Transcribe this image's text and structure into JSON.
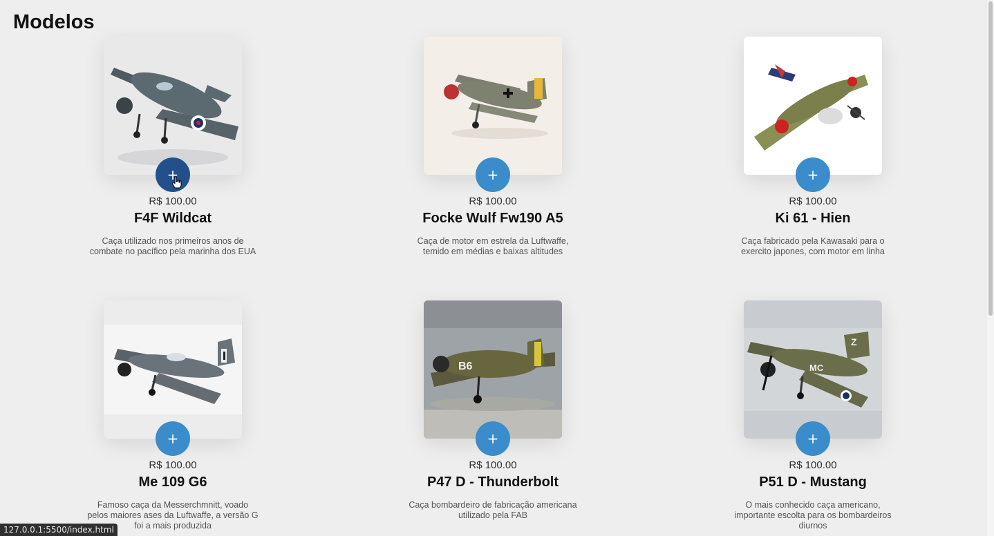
{
  "page": {
    "title": "Modelos"
  },
  "colors": {
    "accent": "#3a8cca",
    "accent_hover": "#23508b",
    "background": "#eeeeee"
  },
  "products": [
    {
      "price": "R$ 100.00",
      "name": "F4F Wildcat",
      "description": "Caça utilizado nos primeiros anos de combate no pacífico pela marinha dos EUA",
      "add_label": "+",
      "state": "hover"
    },
    {
      "price": "R$ 100.00",
      "name": "Focke Wulf Fw190 A5",
      "description": "Caça de motor em estrela da Luftwaffe, temido em médias e baixas altitudes",
      "add_label": "+"
    },
    {
      "price": "R$ 100.00",
      "name": "Ki 61 - Hien",
      "description": "Caça fabricado pela Kawasaki para o exercito japones, com motor em linha",
      "add_label": "+"
    },
    {
      "price": "R$ 100.00",
      "name": "Me 109 G6",
      "description": "Famoso caça da Messerchmnitt, voado pelos maiores ases da Luftwaffe, a versão G foi a mais produzida",
      "add_label": "+"
    },
    {
      "price": "R$ 100.00",
      "name": "P47 D - Thunderbolt",
      "description": "Caça bombardeiro de fabricação americana utilizado pela FAB",
      "add_label": "+"
    },
    {
      "price": "R$ 100.00",
      "name": "P51 D - Mustang",
      "description": "O mais conhecido caça americano, importante escolta para os bombardeiros diurnos",
      "add_label": "+"
    }
  ],
  "status_bar": {
    "url": "127.0.0.1:5500/index.html"
  }
}
